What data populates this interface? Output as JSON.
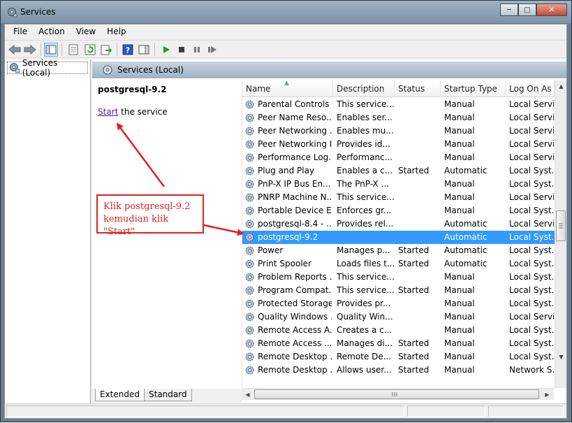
{
  "window": {
    "title": "Services"
  },
  "window_controls": {
    "minimize": "─",
    "maximize": "□",
    "close": "✕"
  },
  "menu": [
    "File",
    "Action",
    "View",
    "Help"
  ],
  "toolbar": {
    "icons": [
      "back-arrow-icon",
      "forward-arrow-icon",
      "console-tree-icon",
      "properties-icon",
      "refresh-icon",
      "export-list-icon",
      "help-icon",
      "action-pane-icon",
      "play-icon",
      "stop-icon",
      "pause-icon",
      "restart-icon"
    ]
  },
  "tree": {
    "root": "Services (Local)"
  },
  "panel": {
    "header": "Services (Local)",
    "selected_service": "postgresql-9.2",
    "start_link": "Start",
    "start_suffix": " the service"
  },
  "table": {
    "columns": [
      "Name",
      "Description",
      "Status",
      "Startup Type",
      "Log On As"
    ],
    "rows": [
      [
        "Parental Controls",
        "This service...",
        "",
        "Manual",
        "Local Servi..."
      ],
      [
        "Peer Name Reso...",
        "Enables ser...",
        "",
        "Manual",
        "Local Servi..."
      ],
      [
        "Peer Networking ...",
        "Enables mu...",
        "",
        "Manual",
        "Local Servi..."
      ],
      [
        "Peer Networking I...",
        "Provides id...",
        "",
        "Manual",
        "Local Servi..."
      ],
      [
        "Performance Log...",
        "Performanc...",
        "",
        "Manual",
        "Local Servi..."
      ],
      [
        "Plug and Play",
        "Enables a c...",
        "Started",
        "Automatic",
        "Local Syst..."
      ],
      [
        "PnP-X IP Bus En...",
        "The PnP-X ...",
        "",
        "Manual",
        "Local Syst..."
      ],
      [
        "PNRP Machine N...",
        "This service...",
        "",
        "Manual",
        "Local Servi..."
      ],
      [
        "Portable Device E...",
        "Enforces gr...",
        "",
        "Manual",
        "Local Syst..."
      ],
      [
        "postgresql-8.4 - ...",
        "Provides rel...",
        "",
        "Automatic",
        "Local Servi..."
      ],
      [
        "postgresql-9.2",
        "",
        "",
        "Automatic",
        "Local Syst..."
      ],
      [
        "Power",
        "Manages p...",
        "Started",
        "Automatic",
        "Local Syst..."
      ],
      [
        "Print Spooler",
        "Loads files t...",
        "Started",
        "Automatic",
        "Local Syst..."
      ],
      [
        "Problem Reports ...",
        "This service...",
        "",
        "Manual",
        "Local Syst..."
      ],
      [
        "Program Compat...",
        "This service...",
        "Started",
        "Manual",
        "Local Syst..."
      ],
      [
        "Protected Storage",
        "Provides pr...",
        "",
        "Manual",
        "Local Syst..."
      ],
      [
        "Quality Windows ...",
        "Quality Win...",
        "",
        "Manual",
        "Local Servi..."
      ],
      [
        "Remote Access A...",
        "Creates a c...",
        "",
        "Manual",
        "Local Syst..."
      ],
      [
        "Remote Access ...",
        "Manages di...",
        "Started",
        "Manual",
        "Local Syst..."
      ],
      [
        "Remote Desktop ...",
        "Remote De...",
        "Started",
        "Manual",
        "Local Syst..."
      ],
      [
        "Remote Desktop ...",
        "Allows user...",
        "Started",
        "Manual",
        "Network S..."
      ]
    ],
    "selected_row": 10
  },
  "tabs": [
    "Extended",
    "Standard"
  ],
  "annotation": {
    "line1": "Klik postgresql-9.2",
    "line2": "kemudian klik \"Start\"",
    "color": "#e02020"
  },
  "colors": {
    "selection": "#3399ff",
    "link": "#551a8b",
    "header": "#9fb2c2"
  }
}
